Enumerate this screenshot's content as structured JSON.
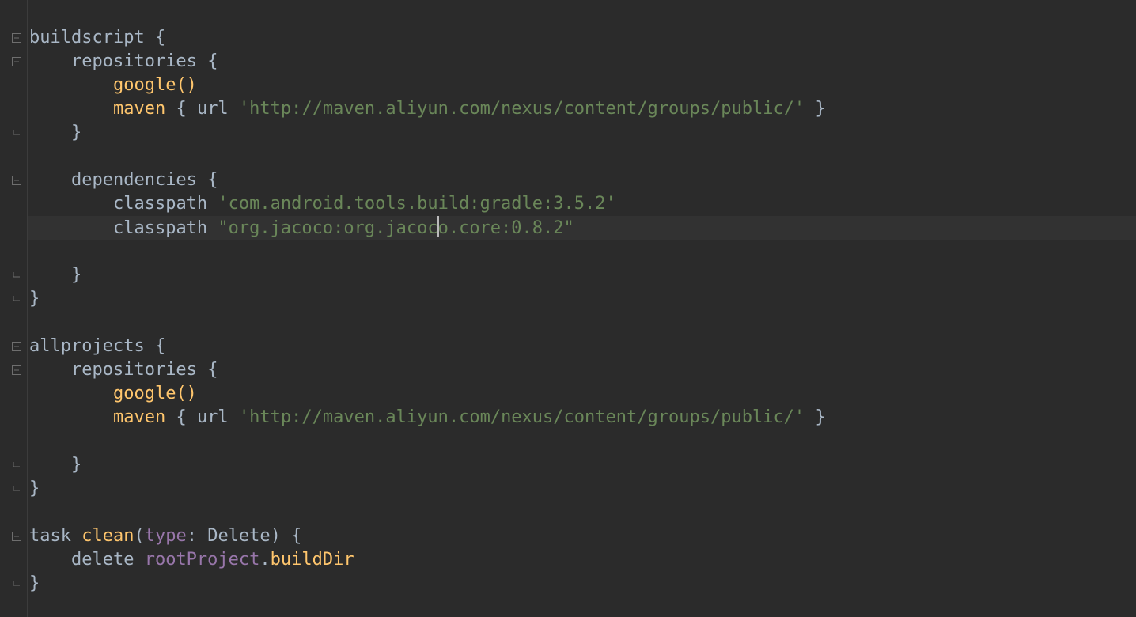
{
  "code": {
    "buildscript": {
      "keyword": "buildscript",
      "open": "{",
      "repositories": {
        "keyword": "repositories",
        "open": "{",
        "google": "google()",
        "maven_kw": "maven",
        "maven_open": "{ url ",
        "maven_url": "'http://maven.aliyun.com/nexus/content/groups/public/'",
        "maven_close": " }",
        "close": "}"
      },
      "dependencies": {
        "keyword": "dependencies",
        "open": "{",
        "cp1_kw": "classpath ",
        "cp1_str": "'com.android.tools.build:gradle:3.5.2'",
        "cp2_kw": "classpath ",
        "cp2_str_a": "\"org.jacoco:org.jacoc",
        "cp2_str_b": "o.core:0.8.2\"",
        "close": "}"
      },
      "close": "}"
    },
    "allprojects": {
      "keyword": "allprojects",
      "open": "{",
      "repositories": {
        "keyword": "repositories",
        "open": "{",
        "google": "google()",
        "maven_kw": "maven",
        "maven_open": "{ url ",
        "maven_url": "'http://maven.aliyun.com/nexus/content/groups/public/'",
        "maven_close": " }",
        "close": "}"
      },
      "close": "}"
    },
    "task": {
      "task_kw": "task",
      "clean": "clean",
      "paren_open": "(",
      "type_kw": "type",
      "colon_delete": ": Delete) {",
      "delete_kw": "delete ",
      "root": "rootProject",
      "dot": ".",
      "buildDir": "buildDir",
      "close": "}"
    }
  }
}
